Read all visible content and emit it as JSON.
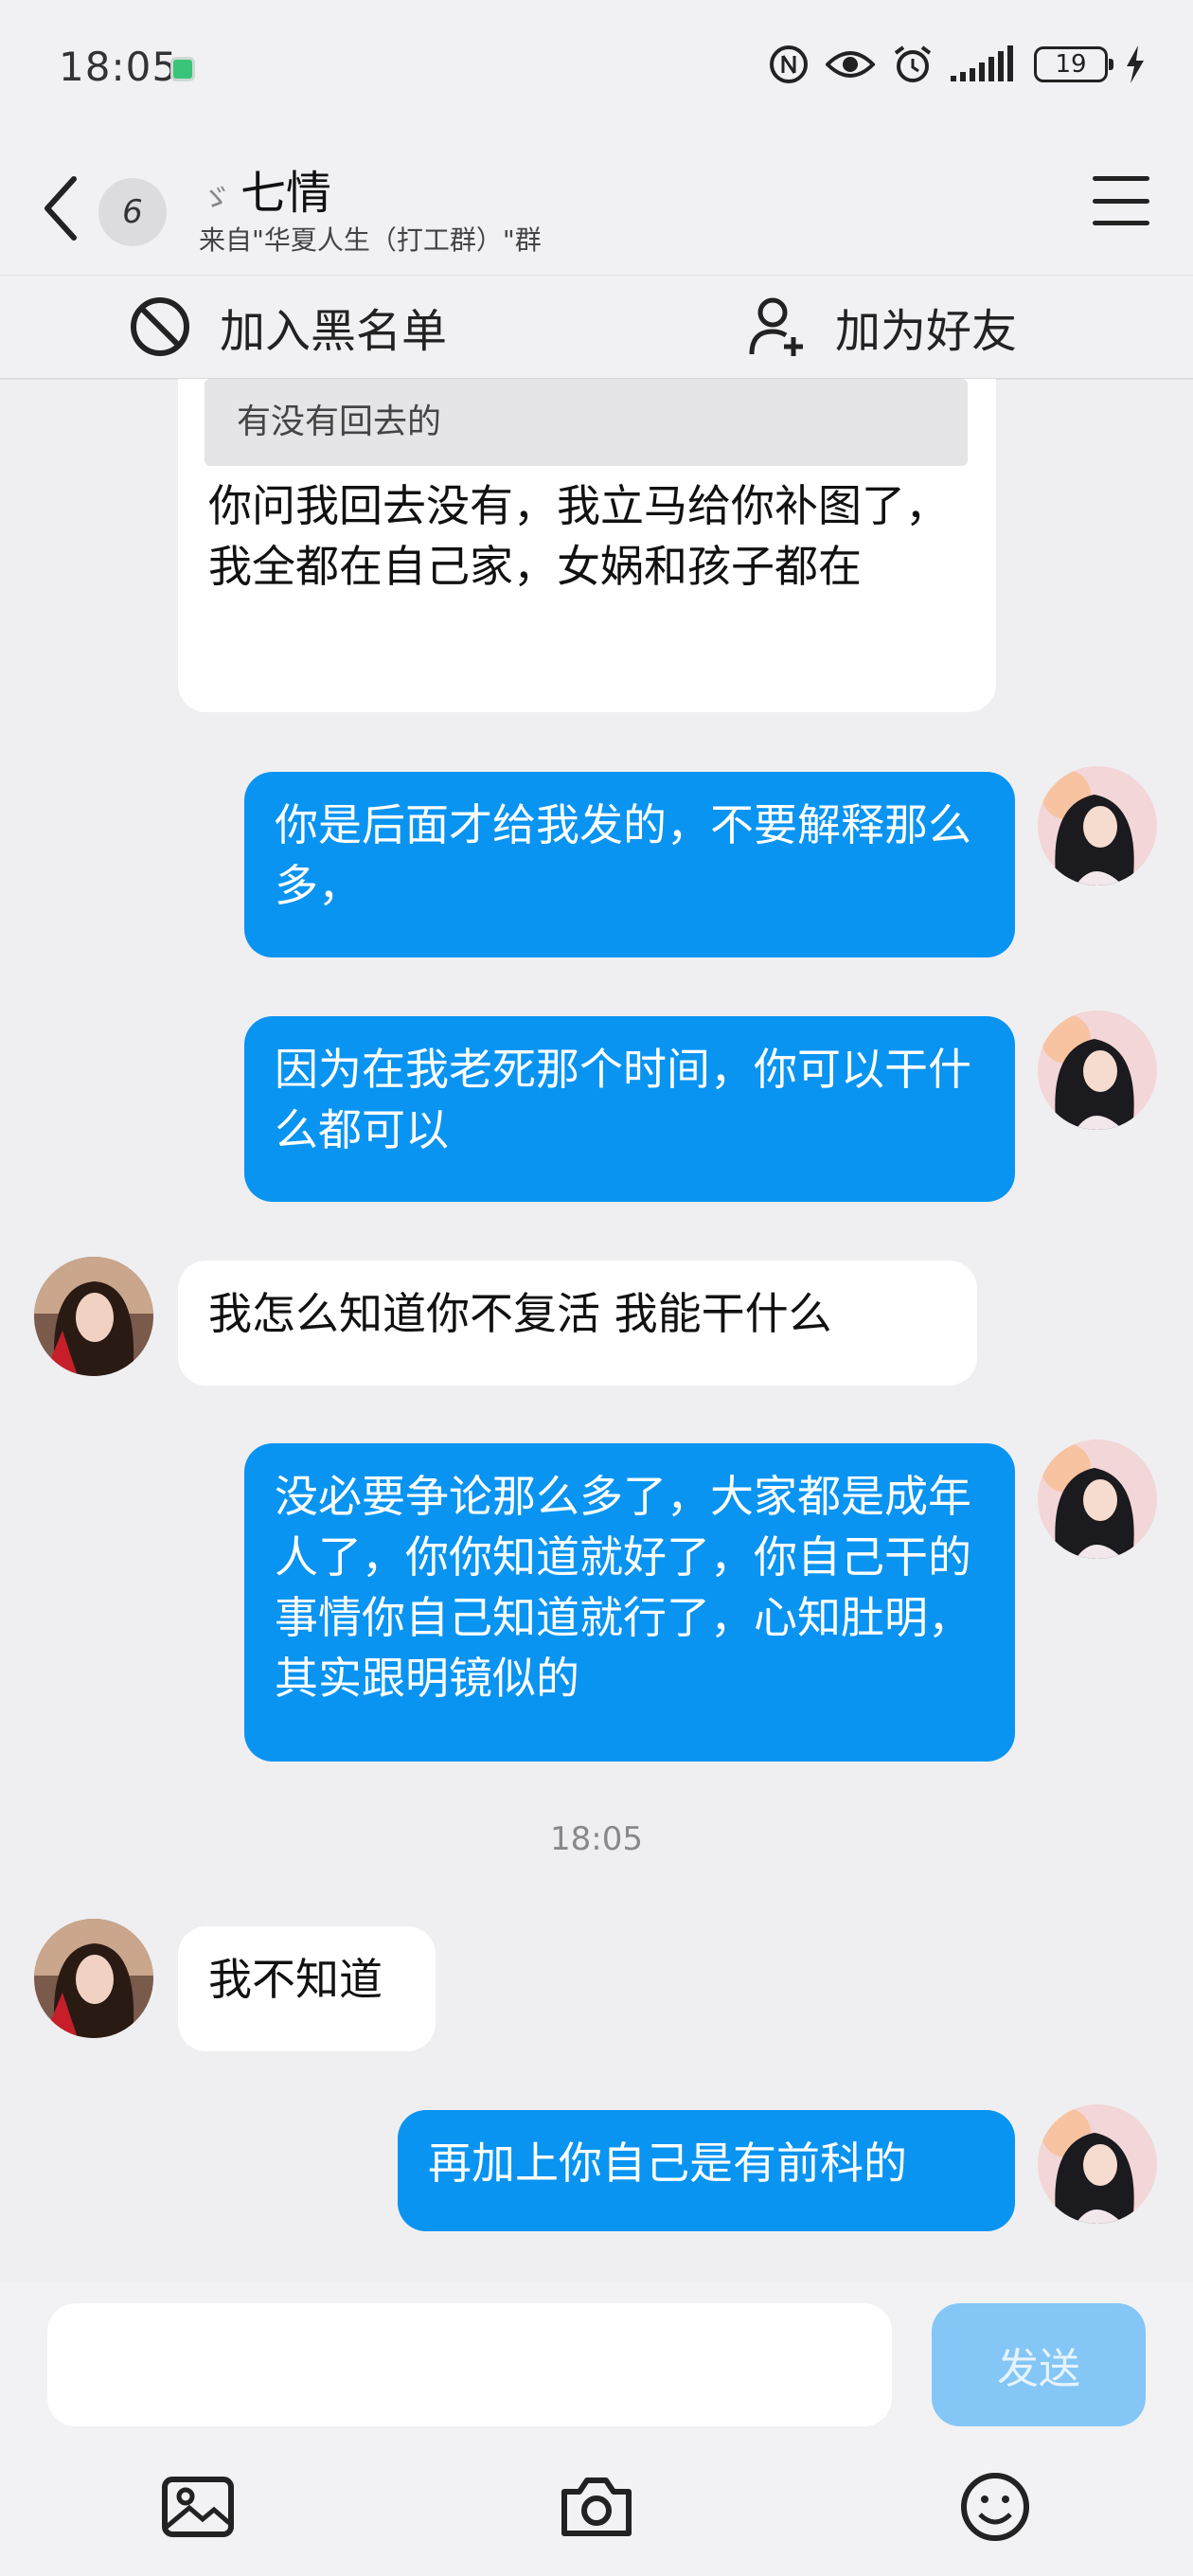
{
  "status": {
    "time": "18:05",
    "battery": "19"
  },
  "header": {
    "unread_count": "6",
    "contact_mark": "ゞ",
    "contact_name": "七情",
    "source": "来自\"华夏人生（打工群）\"群"
  },
  "actions": {
    "block_label": "加入黑名单",
    "add_friend_label": "加为好友"
  },
  "messages": {
    "quoted_text": "有没有回去的",
    "quote_reply": "你问我回去没有，我立马给你补图了，我全都在自己家，女娲和孩子都在",
    "m1": "你是后面才给我发的，不要解释那么多，",
    "m2": "因为在我老死那个时间，你可以干什么都可以",
    "m3": "我怎么知道你不复活  我能干什么",
    "m4": "没必要争论那么多了，大家都是成年人了，你你知道就好了，你自己干的事情你自己知道就行了，心知肚明，其实跟明镜似的",
    "timestamp": "18:05",
    "m5": "我不知道",
    "m6": "再加上你自己是有前科的"
  },
  "input": {
    "placeholder": "",
    "send_label": "发送"
  },
  "icons": [
    "back-icon",
    "menu-icon",
    "block-icon",
    "add-friend-icon",
    "image-icon",
    "camera-icon",
    "emoji-icon"
  ],
  "colors": {
    "my_bubble": "#0a94f2",
    "their_bubble": "#ffffff",
    "send_button": "#84c6f6",
    "background": "#efeff1"
  }
}
